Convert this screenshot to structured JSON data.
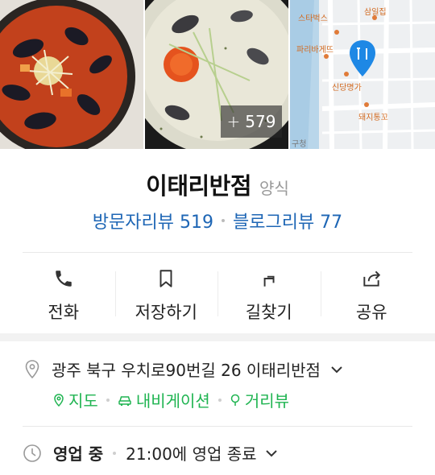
{
  "gallery": {
    "photo_count_prefix": "+",
    "photo_count": "579",
    "map_labels": {
      "starbucks": "스타벅스",
      "samil": "삼일집",
      "paris": "파리바게뜨",
      "sindang": "신당명가",
      "dweji": "돼지통꼬",
      "gu": "구청"
    }
  },
  "place": {
    "name": "이태리반점",
    "category": "양식"
  },
  "reviews": {
    "visitor": "방문자리뷰 519",
    "blog": "블로그리뷰 77"
  },
  "actions": [
    {
      "label": "전화",
      "icon": "phone-icon"
    },
    {
      "label": "저장하기",
      "icon": "bookmark-icon"
    },
    {
      "label": "길찾기",
      "icon": "directions-icon"
    },
    {
      "label": "공유",
      "icon": "share-icon"
    }
  ],
  "address": {
    "text": "광주 북구 우치로90번길 26 이태리반점",
    "links": [
      "지도",
      "내비게이션",
      "거리뷰"
    ]
  },
  "hours": {
    "status": "영업 중",
    "detail": "21:00에 영업 종료"
  },
  "colors": {
    "link_blue": "#1e66b5",
    "link_green": "#1fb451",
    "map_pin_blue": "#1e88e5"
  }
}
